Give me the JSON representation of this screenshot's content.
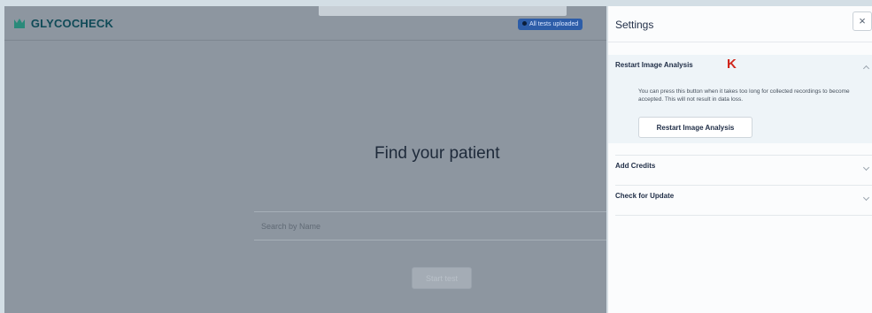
{
  "app": {
    "logo_text": "GLYCOCHECK",
    "status_text": "All tests uploaded",
    "find_title": "Find your patient",
    "search_placeholder": "Search by Name",
    "start_button": "Start test"
  },
  "settings": {
    "title": "Settings",
    "close_label": "×",
    "annotation_letter": "K",
    "sections": [
      {
        "label": "Restart Image Analysis",
        "expanded": true,
        "description": "You can press this button when it takes too long for collected recordings to become accepted. This will not result in data loss.",
        "action_label": "Restart Image Analysis"
      },
      {
        "label": "Add Credits",
        "expanded": false
      },
      {
        "label": "Check for Update",
        "expanded": false
      }
    ]
  },
  "colors": {
    "overlay": "#8d96a0",
    "panel_bg": "#fbfcfd",
    "accent": "#2d5da8",
    "annotation": "#d0261c"
  }
}
